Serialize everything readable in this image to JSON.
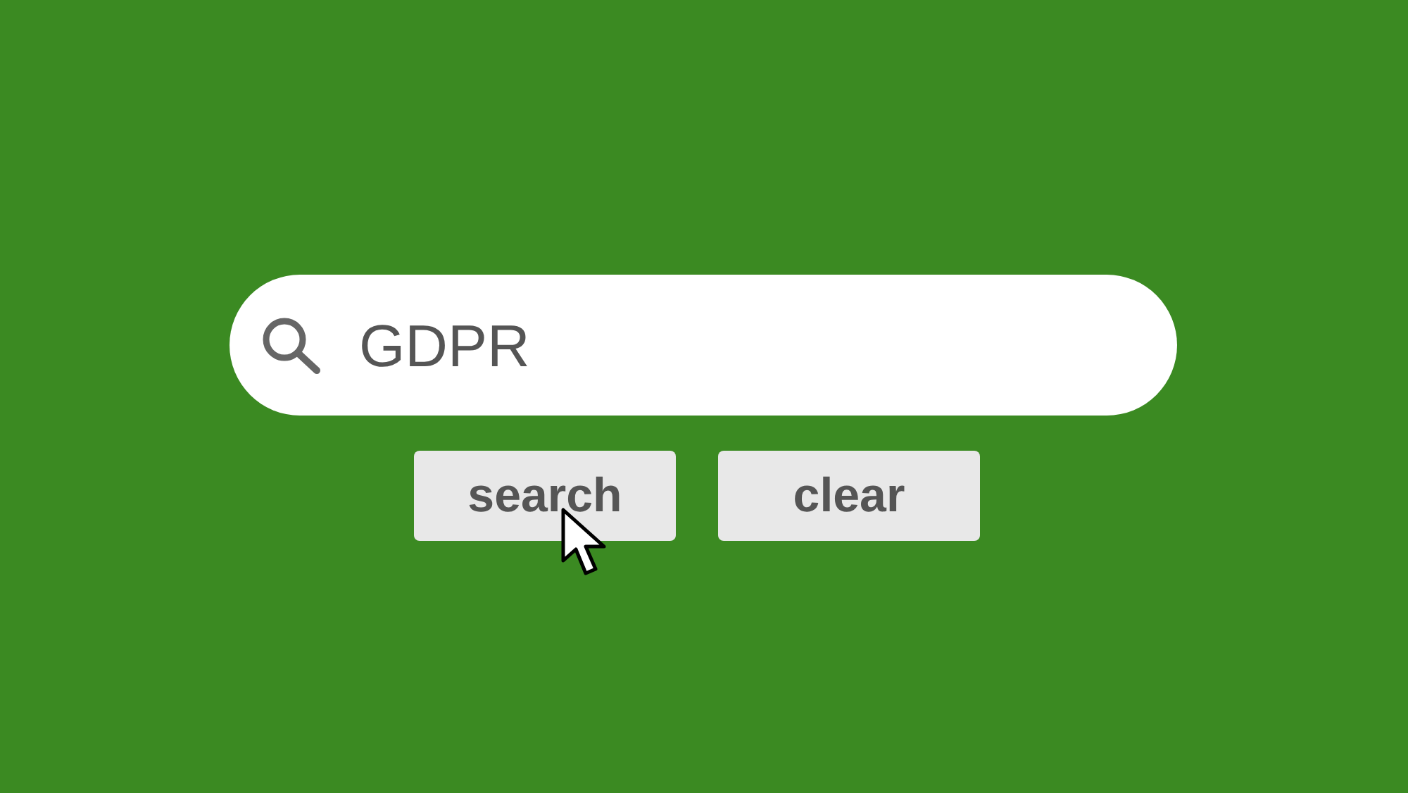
{
  "search": {
    "value": "GDPR"
  },
  "buttons": [
    {
      "label": "search",
      "hovered": true
    },
    {
      "label": "clear",
      "hovered": false
    }
  ]
}
